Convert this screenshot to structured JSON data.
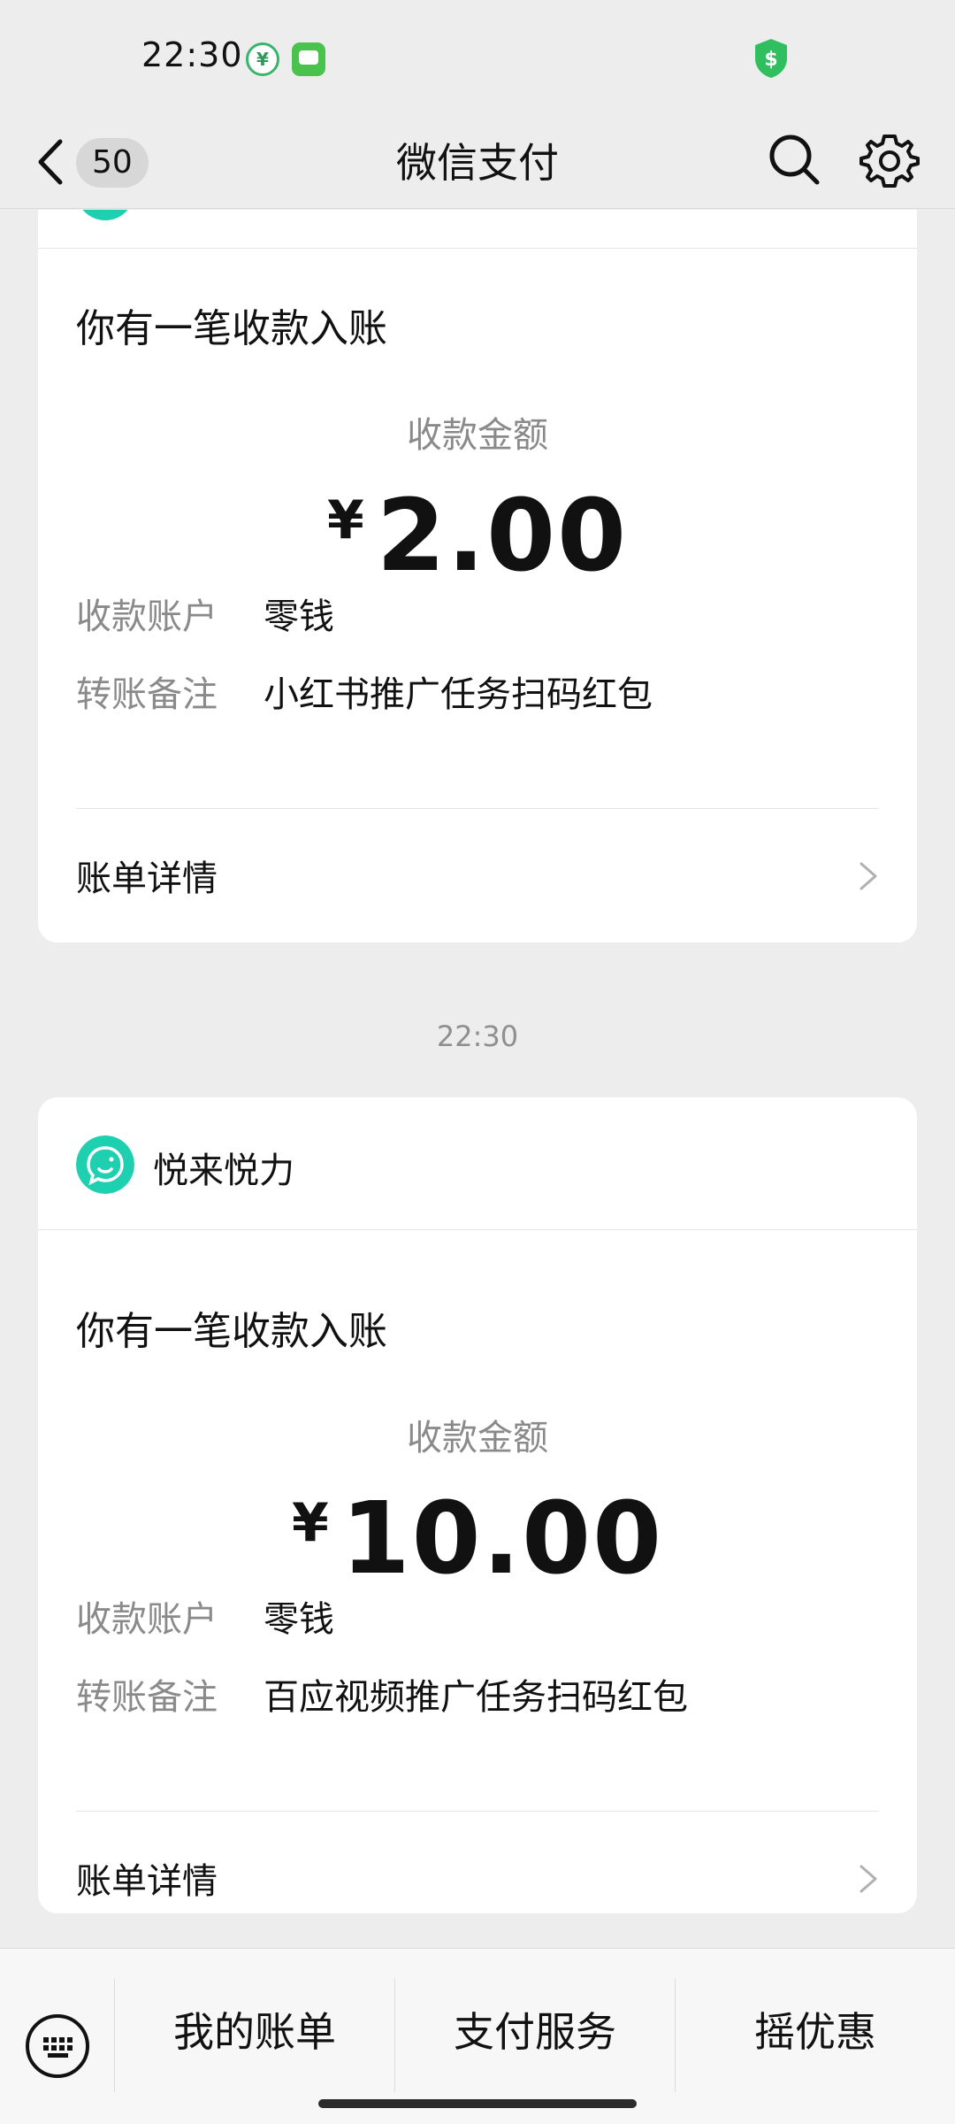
{
  "status_bar": {
    "time": "22:30",
    "icons": [
      "wallet-app-icon",
      "messages-app-icon",
      "security-shield-icon"
    ]
  },
  "nav": {
    "unread_count": "50",
    "title": "微信支付",
    "icons": [
      "back-chevron-icon",
      "search-icon",
      "gear-icon"
    ]
  },
  "cards": [
    {
      "title": "你有一笔收款入账",
      "amount_label": "收款金额",
      "currency": "¥",
      "amount": "2.00",
      "account_label": "收款账户",
      "account_value": "零钱",
      "remark_label": "转账备注",
      "remark_value": "小红书推广任务扫码红包",
      "detail_label": "账单详情"
    },
    {
      "merchant_name": "悦来悦力",
      "title": "你有一笔收款入账",
      "amount_label": "收款金额",
      "currency": "¥",
      "amount": "10.00",
      "account_label": "收款账户",
      "account_value": "零钱",
      "remark_label": "转账备注",
      "remark_value": "百应视频推广任务扫码红包",
      "detail_label": "账单详情"
    }
  ],
  "time_separator": "22:30",
  "bottom_menu": {
    "items": [
      "我的账单",
      "支付服务",
      "摇优惠"
    ],
    "icons": [
      "keyboard-icon"
    ]
  },
  "colors": {
    "background": "#ededed",
    "card": "#ffffff",
    "accent_green": "#1fd0b0",
    "secondary_text": "#8a8a8a"
  }
}
